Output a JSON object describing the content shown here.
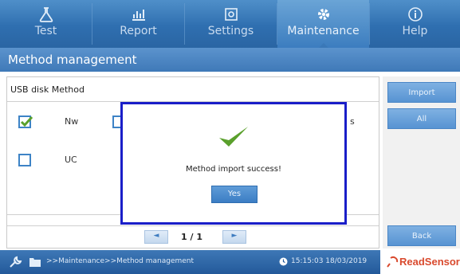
{
  "nav": {
    "tabs": [
      {
        "label": "Test",
        "icon": "flask-icon"
      },
      {
        "label": "Report",
        "icon": "chart-icon"
      },
      {
        "label": "Settings",
        "icon": "settings-icon"
      },
      {
        "label": "Maintenance",
        "icon": "gear-icon"
      },
      {
        "label": "Help",
        "icon": "info-icon"
      }
    ],
    "active_tab": "Maintenance"
  },
  "title": "Method management",
  "panel": {
    "title": "USB disk Method",
    "rows": [
      {
        "name": "Nw",
        "checked": true,
        "trailing": "s"
      },
      {
        "name": "UC",
        "checked": false,
        "trailing": ""
      }
    ],
    "pager": {
      "prev": "◄",
      "next": "►",
      "page": "1 / 1"
    }
  },
  "side_buttons": {
    "import": "Import",
    "all": "All",
    "back": "Back"
  },
  "dialog": {
    "message": "Method import success!",
    "yes": "Yes"
  },
  "status": {
    "path": ">>Maintenance>>Method management",
    "clock": "15:15:03 18/03/2019"
  },
  "brand": {
    "name": "ReadSensor",
    "color": "#d94a2e"
  },
  "colors": {
    "nav": "#2f6fb0",
    "accent": "#3d83c6",
    "dialog_border": "#1a1ec8",
    "check": "#5aa02c"
  }
}
